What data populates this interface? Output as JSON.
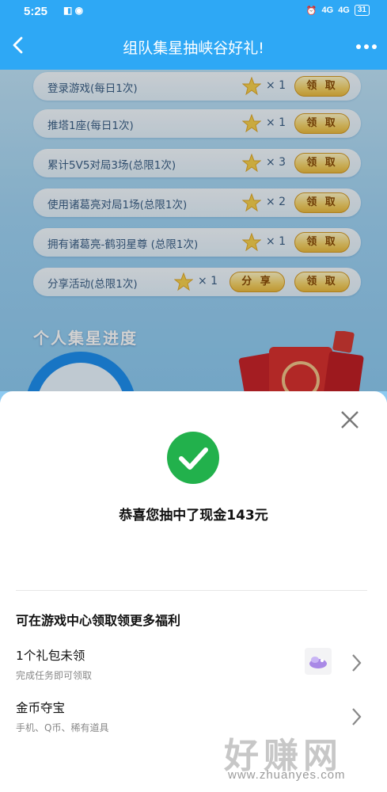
{
  "status_bar": {
    "time": "5:25",
    "signal_left": "4G",
    "signal_right": "4G",
    "battery": "31"
  },
  "header": {
    "title": "组队集星抽峡谷好礼!"
  },
  "tasks": [
    {
      "label": "登录游戏(每日1次)",
      "multiplier": "× 1",
      "claim_label": "领 取"
    },
    {
      "label": "推塔1座(每日1次)",
      "multiplier": "× 1",
      "claim_label": "领 取"
    },
    {
      "label": "累计5V5对局3场(总限1次)",
      "multiplier": "× 3",
      "claim_label": "领 取"
    },
    {
      "label": "使用诸葛亮对局1场(总限1次)",
      "multiplier": "× 2",
      "claim_label": "领 取"
    },
    {
      "label": "拥有诸葛亮-鹤羽星尊 (总限1次)",
      "multiplier": "× 1",
      "claim_label": "领 取"
    },
    {
      "label": "分享活动(总限1次)",
      "multiplier": "× 1",
      "share_label": "分 享",
      "claim_label": "领 取"
    }
  ],
  "progress": {
    "title": "个人集星进度"
  },
  "dialog": {
    "message": "恭喜您抽中了现金143元",
    "section_title": "可在游戏中心领取领更多福利",
    "items": [
      {
        "title": "1个礼包未领",
        "subtitle": "完成任务即可领取"
      },
      {
        "title": "金币夺宝",
        "subtitle": "手机、Q币、稀有道具"
      }
    ]
  },
  "watermark": {
    "text": "好赚网",
    "url": "www.zhuanyes.com"
  },
  "colors": {
    "header_blue": "#2ea8f5",
    "success_green": "#22b14c",
    "gold": "#f5d36a"
  }
}
